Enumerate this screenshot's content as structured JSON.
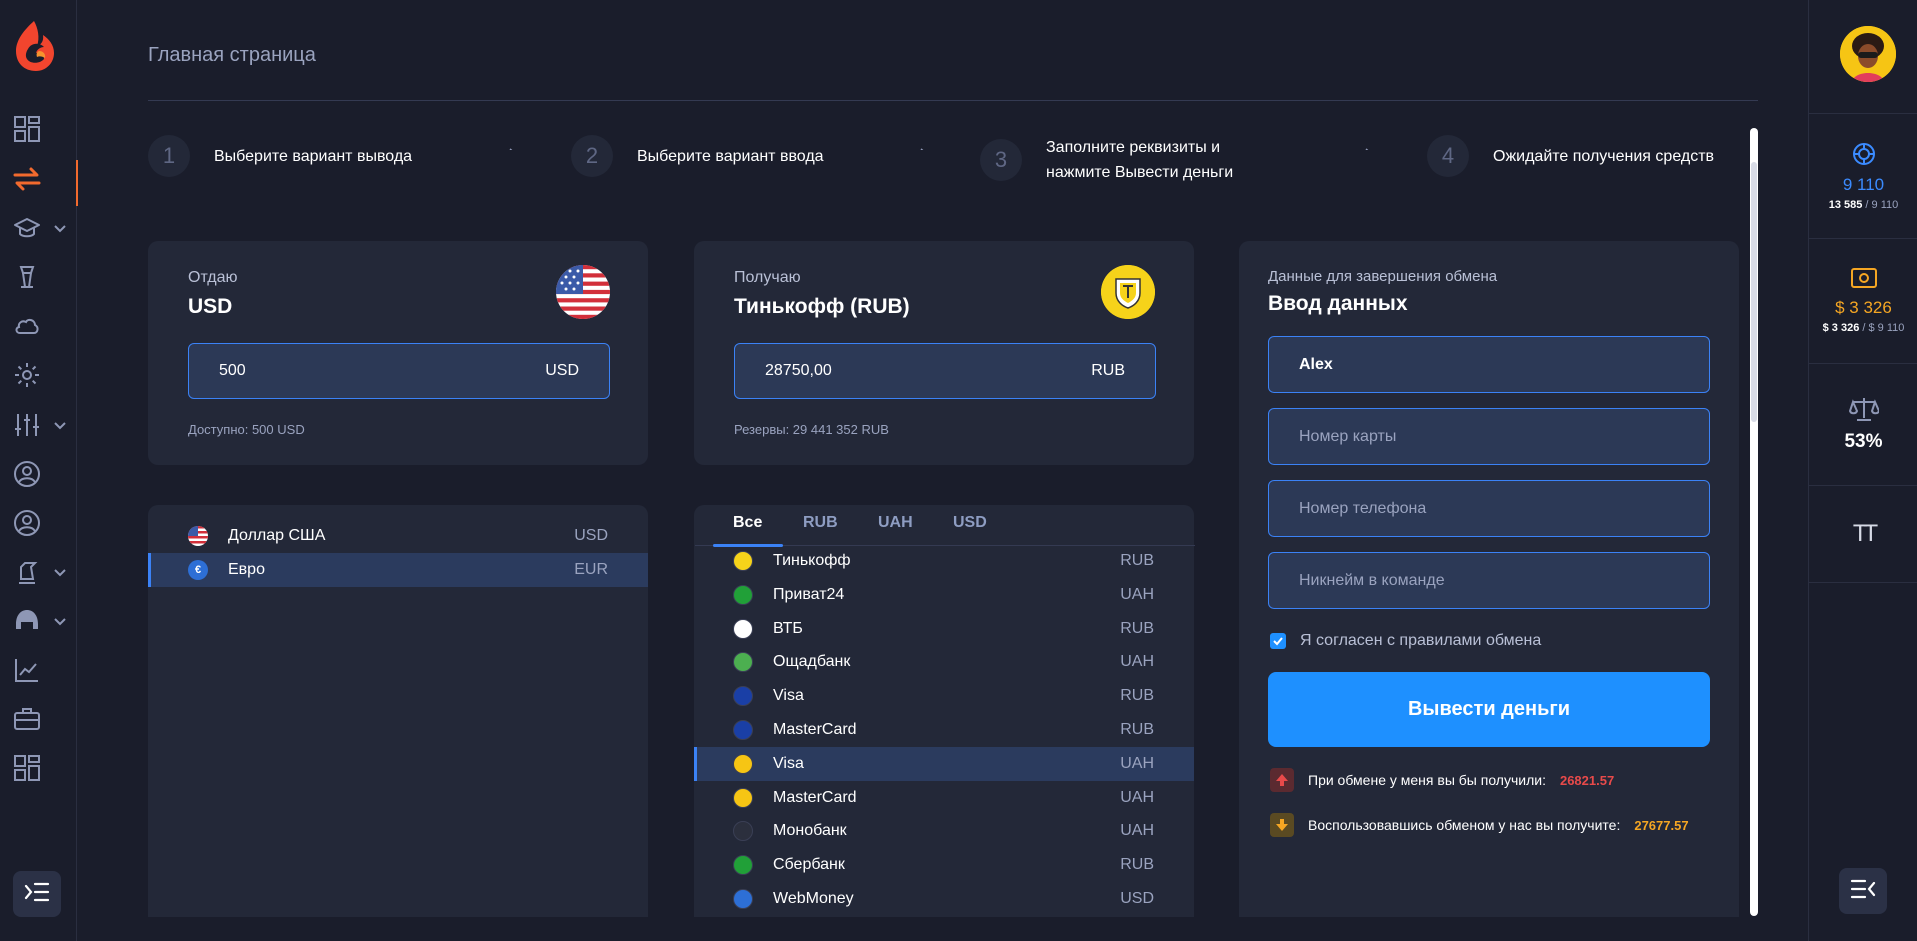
{
  "header": {
    "title": "Главная страница"
  },
  "steps": [
    {
      "num": "1",
      "text": "Выберите вариант вывода"
    },
    {
      "num": "2",
      "text": "Выберите вариант ввода"
    },
    {
      "num": "3",
      "text_line1": "Заполните реквизиты и",
      "text_line2": "нажмите Вывести деньги"
    },
    {
      "num": "4",
      "text": "Ожидайте получения средств"
    }
  ],
  "give": {
    "label": "Отдаю",
    "currency": "USD",
    "amount": "500",
    "amount_currency": "USD",
    "available": "Доступно: 500 USD"
  },
  "receive": {
    "label": "Получаю",
    "currency": "Тинькофф (RUB)",
    "amount": "28750,00",
    "amount_currency": "RUB",
    "reserves": "Резервы: 29 441 352 RUB"
  },
  "give_list": [
    {
      "icon": "us-flag-icon",
      "name": "Доллар США",
      "code": "USD",
      "selected": false
    },
    {
      "icon": "euro-icon",
      "name": "Евро",
      "code": "EUR",
      "selected": true
    }
  ],
  "receive_tabs": [
    "Все",
    "RUB",
    "UAH",
    "USD"
  ],
  "receive_list": [
    {
      "icon": "tinkoff-icon",
      "name": "Тинькофф",
      "code": "RUB",
      "color": "#f6d31a",
      "selected": false
    },
    {
      "icon": "privat24-icon",
      "name": "Приват24",
      "code": "UAH",
      "color": "#21a038",
      "selected": false
    },
    {
      "icon": "vtb-icon",
      "name": "ВТБ",
      "code": "RUB",
      "color": "#ffffff",
      "selected": false
    },
    {
      "icon": "oschadbank-icon",
      "name": "Ощадбанк",
      "code": "UAH",
      "color": "#4caf50",
      "selected": false
    },
    {
      "icon": "visa-icon",
      "name": "Visa",
      "code": "RUB",
      "color": "#1a3fa6",
      "selected": false
    },
    {
      "icon": "mastercard-icon",
      "name": "MasterCard",
      "code": "RUB",
      "color": "#1a3fa6",
      "selected": false
    },
    {
      "icon": "visa-icon",
      "name": "Visa",
      "code": "UAH",
      "color": "#f6c514",
      "selected": true
    },
    {
      "icon": "mastercard-icon",
      "name": "MasterCard",
      "code": "UAH",
      "color": "#f6c514",
      "selected": false
    },
    {
      "icon": "monobank-icon",
      "name": "Монобанк",
      "code": "UAH",
      "color": "#2b2f3d",
      "selected": false
    },
    {
      "icon": "sberbank-icon",
      "name": "Сбербанк",
      "code": "RUB",
      "color": "#21a038",
      "selected": false
    },
    {
      "icon": "webmoney-icon",
      "name": "WebMoney",
      "code": "USD",
      "color": "#2d6fd6",
      "selected": false
    }
  ],
  "form": {
    "label": "Данные для завершения обмена",
    "title": "Ввод данных",
    "name_value": "Alex",
    "card_placeholder": "Номер карты",
    "phone_placeholder": "Номер телефона",
    "nick_placeholder": "Никнейм в команде",
    "agree_label": "Я согласен с правилами обмена",
    "submit_label": "Вывести деньги",
    "info1_text": "При обмене у меня вы бы получили:",
    "info1_value": "26821.57",
    "info2_text": "Воспользовавшись обменом у нас вы получите:",
    "info2_value": "27677.57"
  },
  "right_panel": {
    "coins_value": "9 110",
    "coins_sub_main": "13 585",
    "coins_sub_rest": " / 9 110",
    "cash_value": "$ 3 326",
    "cash_sub_main": "$ 3 326",
    "cash_sub_rest": " / $ 9 110",
    "balance_percent": "53%",
    "font_size_label": "TT"
  },
  "colors": {
    "accent": "#1e90ff",
    "brand": "#f26a2e",
    "coins": "#3b8bff",
    "cash": "#f5a623",
    "loss": "#e84a4a",
    "gain": "#f5a623"
  }
}
